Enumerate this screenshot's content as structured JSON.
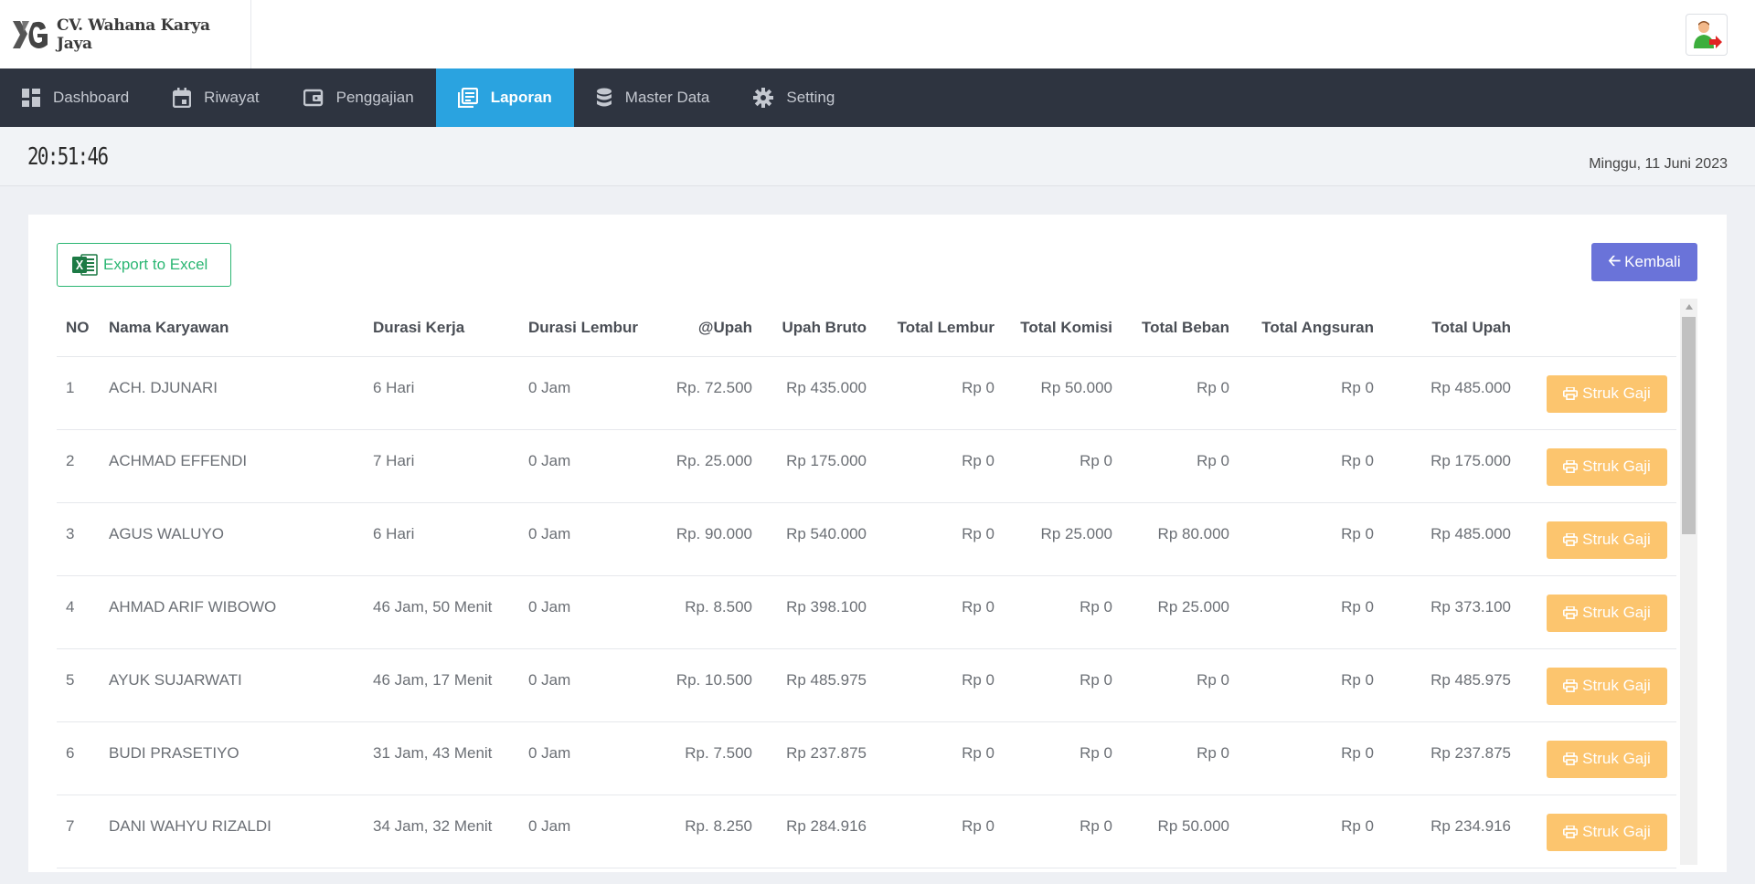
{
  "header": {
    "company_name": "CV. Wahana Karya Jaya"
  },
  "nav": {
    "items": [
      {
        "label": "Dashboard",
        "icon": "dashboard-icon",
        "active": false
      },
      {
        "label": "Riwayat",
        "icon": "calendar-icon",
        "active": false
      },
      {
        "label": "Penggajian",
        "icon": "wallet-icon",
        "active": false
      },
      {
        "label": "Laporan",
        "icon": "report-icon",
        "active": true
      },
      {
        "label": "Master Data",
        "icon": "database-icon",
        "active": false
      },
      {
        "label": "Setting",
        "icon": "gear-icon",
        "active": false
      }
    ]
  },
  "clock": {
    "time": "20:51:46",
    "date": "Minggu, 11 Juni 2023"
  },
  "actions": {
    "export_label": "Export to Excel",
    "back_label": "Kembali"
  },
  "table": {
    "headers": [
      "NO",
      "Nama Karyawan",
      "Durasi Kerja",
      "Durasi Lembur",
      "@Upah",
      "Upah Bruto",
      "Total Lembur",
      "Total Komisi",
      "Total Beban",
      "Total Angsuran",
      "Total Upah",
      ""
    ],
    "action_label": "Struk Gaji",
    "rows": [
      [
        "1",
        "ACH. DJUNARI",
        "6 Hari",
        "0 Jam",
        "Rp. 72.500",
        "Rp 435.000",
        "Rp 0",
        "Rp 50.000",
        "Rp 0",
        "Rp 0",
        "Rp 485.000"
      ],
      [
        "2",
        "ACHMAD EFFENDI",
        "7 Hari",
        "0 Jam",
        "Rp. 25.000",
        "Rp 175.000",
        "Rp 0",
        "Rp 0",
        "Rp 0",
        "Rp 0",
        "Rp 175.000"
      ],
      [
        "3",
        "AGUS WALUYO",
        "6 Hari",
        "0 Jam",
        "Rp. 90.000",
        "Rp 540.000",
        "Rp 0",
        "Rp 25.000",
        "Rp 80.000",
        "Rp 0",
        "Rp 485.000"
      ],
      [
        "4",
        "AHMAD ARIF WIBOWO",
        "46 Jam, 50 Menit",
        "0 Jam",
        "Rp. 8.500",
        "Rp 398.100",
        "Rp 0",
        "Rp 0",
        "Rp 25.000",
        "Rp 0",
        "Rp 373.100"
      ],
      [
        "5",
        "AYUK SUJARWATI",
        "46 Jam, 17 Menit",
        "0 Jam",
        "Rp. 10.500",
        "Rp 485.975",
        "Rp 0",
        "Rp 0",
        "Rp 0",
        "Rp 0",
        "Rp 485.975"
      ],
      [
        "6",
        "BUDI PRASETIYO",
        "31 Jam, 43 Menit",
        "0 Jam",
        "Rp. 7.500",
        "Rp 237.875",
        "Rp 0",
        "Rp 0",
        "Rp 0",
        "Rp 0",
        "Rp 237.875"
      ],
      [
        "7",
        "DANI WAHYU RIZALDI",
        "34 Jam, 32 Menit",
        "0 Jam",
        "Rp. 8.250",
        "Rp 284.916",
        "Rp 0",
        "Rp 0",
        "Rp 50.000",
        "Rp 0",
        "Rp 234.916"
      ]
    ]
  },
  "colors": {
    "navbar": "#2e3440",
    "nav_active": "#2aa3e0",
    "excel_green": "#2bb673",
    "back_button": "#6a73d9",
    "struk_button": "#fcc56e"
  }
}
